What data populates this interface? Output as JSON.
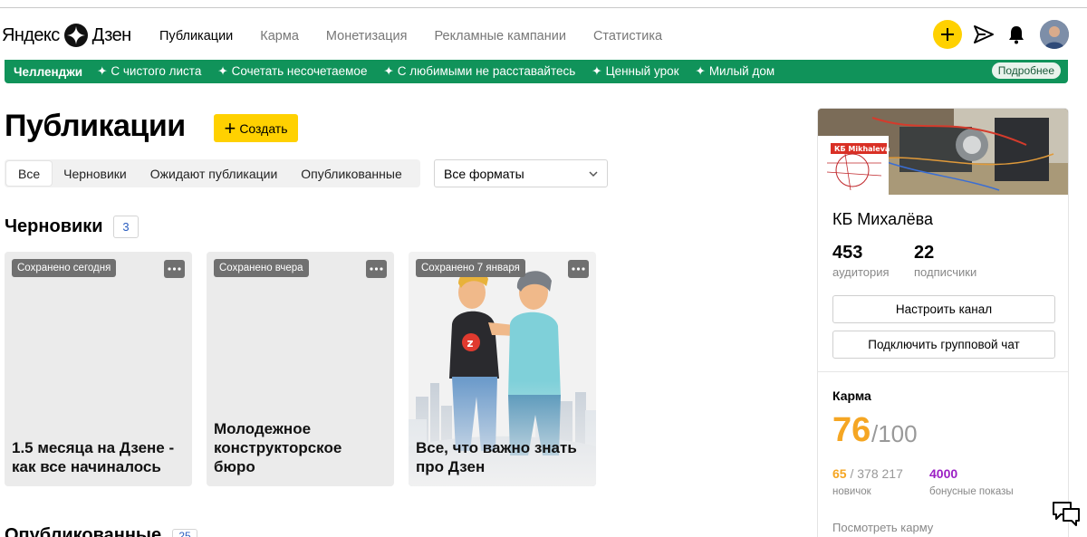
{
  "header": {
    "logo_left": "Яндекс",
    "logo_right": "Дзен",
    "nav": [
      {
        "label": "Публикации",
        "active": true
      },
      {
        "label": "Карма",
        "active": false
      },
      {
        "label": "Монетизация",
        "active": false
      },
      {
        "label": "Рекламные кампании",
        "active": false
      },
      {
        "label": "Статистика",
        "active": false
      }
    ],
    "icons": [
      "plus-icon",
      "send-icon",
      "bell-icon",
      "avatar"
    ]
  },
  "banner": {
    "title": "Челленджи",
    "items": [
      "С чистого листа",
      "Сочетать несочетаемое",
      "С любимыми не расставайтесь",
      "Ценный урок",
      "Милый дом"
    ],
    "more": "Подробнее",
    "color": "#10935a"
  },
  "main": {
    "title": "Публикации",
    "create_label": "Создать",
    "tabs": [
      {
        "label": "Все",
        "active": true
      },
      {
        "label": "Черновики",
        "active": false
      },
      {
        "label": "Ожидают публикации",
        "active": false
      },
      {
        "label": "Опубликованные",
        "active": false
      }
    ],
    "format_select": "Все форматы",
    "drafts_heading": "Черновики",
    "drafts_count": "3",
    "drafts": [
      {
        "saved": "Сохранено сегодня",
        "title": "1.5 месяца на Дзене - как все начиналось"
      },
      {
        "saved": "Сохранено вчера",
        "title": "Молодежное конструкторское бюро"
      },
      {
        "saved": "Сохранено 7 января",
        "title": "Все, что важно знать про Дзен"
      }
    ],
    "published_heading": "Опубликованные",
    "published_count": "25"
  },
  "panel": {
    "cover_label": "КБ Mikhaleva",
    "channel_name": "КБ Михалёва",
    "audience": "453",
    "audience_label": "аудитория",
    "subscribers": "22",
    "subscribers_label": "подписчики",
    "configure_label": "Настроить канал",
    "group_chat_label": "Подключить групповой чат",
    "karma_title": "Карма",
    "karma_value": "76",
    "karma_max": "/100",
    "rank_value": "65",
    "rank_total": " / 378 217",
    "rank_label": "новичок",
    "bonus_value": "4000",
    "bonus_label": "бонусные показы",
    "karma_link": "Посмотреть карму",
    "accent_karma": "#f5a623",
    "accent_bonus": "#9b1fc4"
  }
}
